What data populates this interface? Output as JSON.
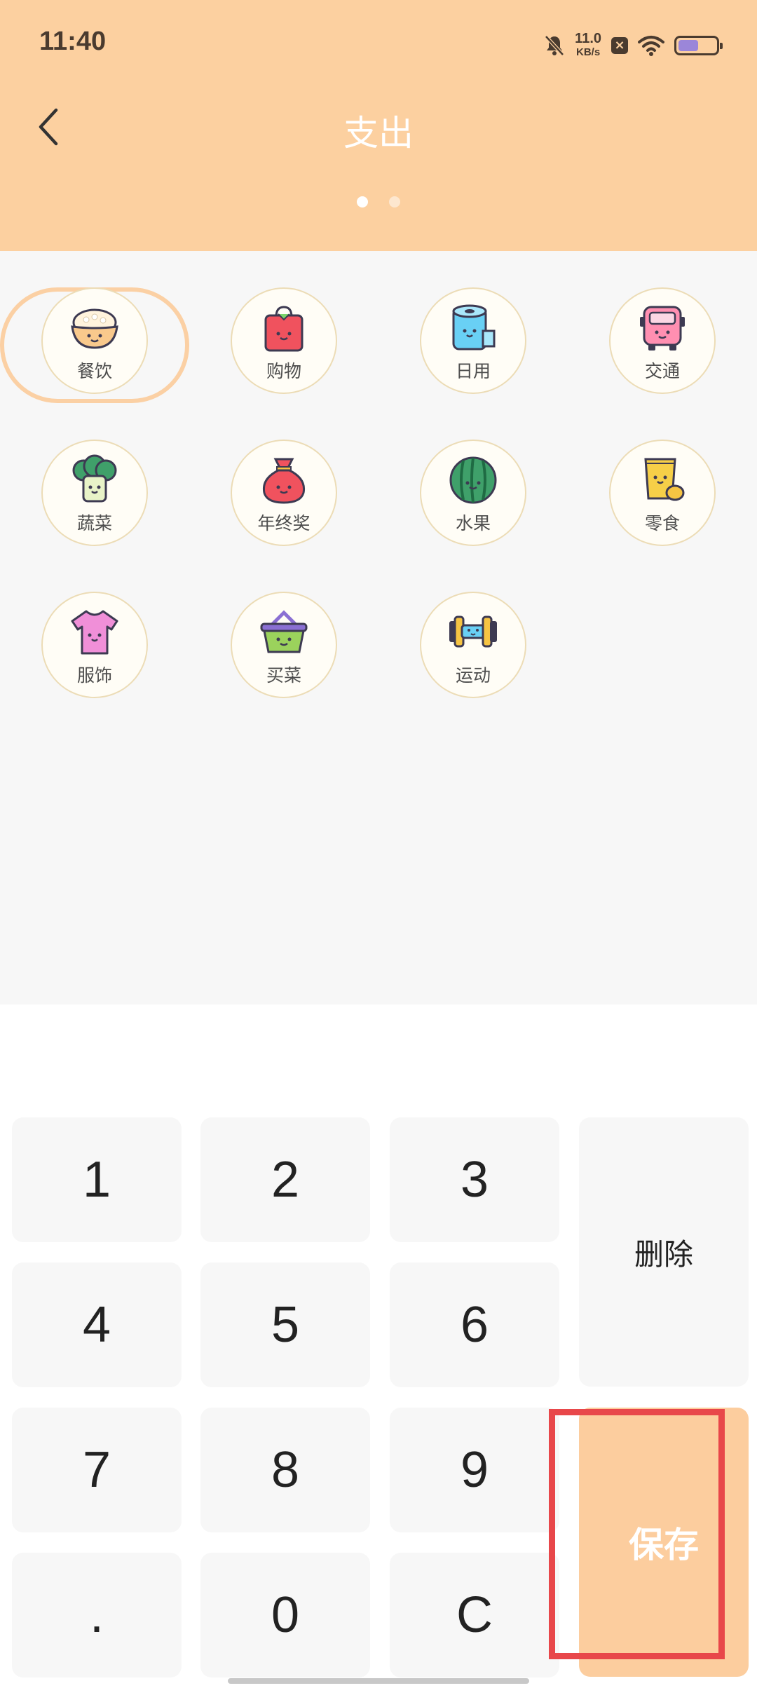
{
  "status_bar": {
    "time": "11:40",
    "net_speed_value": "11.0",
    "net_speed_unit": "KB/s",
    "icons": [
      "bell-muted-icon",
      "close-box-icon",
      "wifi-icon",
      "battery-icon"
    ]
  },
  "header": {
    "title": "支出",
    "back_icon": "chevron-left-icon",
    "pages": 2,
    "active_page": 1
  },
  "categories": [
    {
      "label": "餐饮",
      "icon": "rice-bowl-icon",
      "selected": true
    },
    {
      "label": "购物",
      "icon": "shopping-bag-icon"
    },
    {
      "label": "日用",
      "icon": "toilet-paper-icon"
    },
    {
      "label": "交通",
      "icon": "bus-icon"
    },
    {
      "label": "蔬菜",
      "icon": "broccoli-icon"
    },
    {
      "label": "年终奖",
      "icon": "money-bag-icon"
    },
    {
      "label": "水果",
      "icon": "watermelon-icon"
    },
    {
      "label": "零食",
      "icon": "snack-bag-icon"
    },
    {
      "label": "服饰",
      "icon": "tshirt-icon"
    },
    {
      "label": "买菜",
      "icon": "basket-icon"
    },
    {
      "label": "运动",
      "icon": "dumbbell-icon"
    }
  ],
  "keypad": {
    "keys": [
      "1",
      "2",
      "3",
      "4",
      "5",
      "6",
      "7",
      "8",
      "9",
      ".",
      "0",
      "C"
    ],
    "delete_label": "删除",
    "save_label": "保存"
  },
  "colors": {
    "header_bg": "#fcd0a0",
    "save_bg": "#fccd9e",
    "highlight": "#e8474a"
  }
}
